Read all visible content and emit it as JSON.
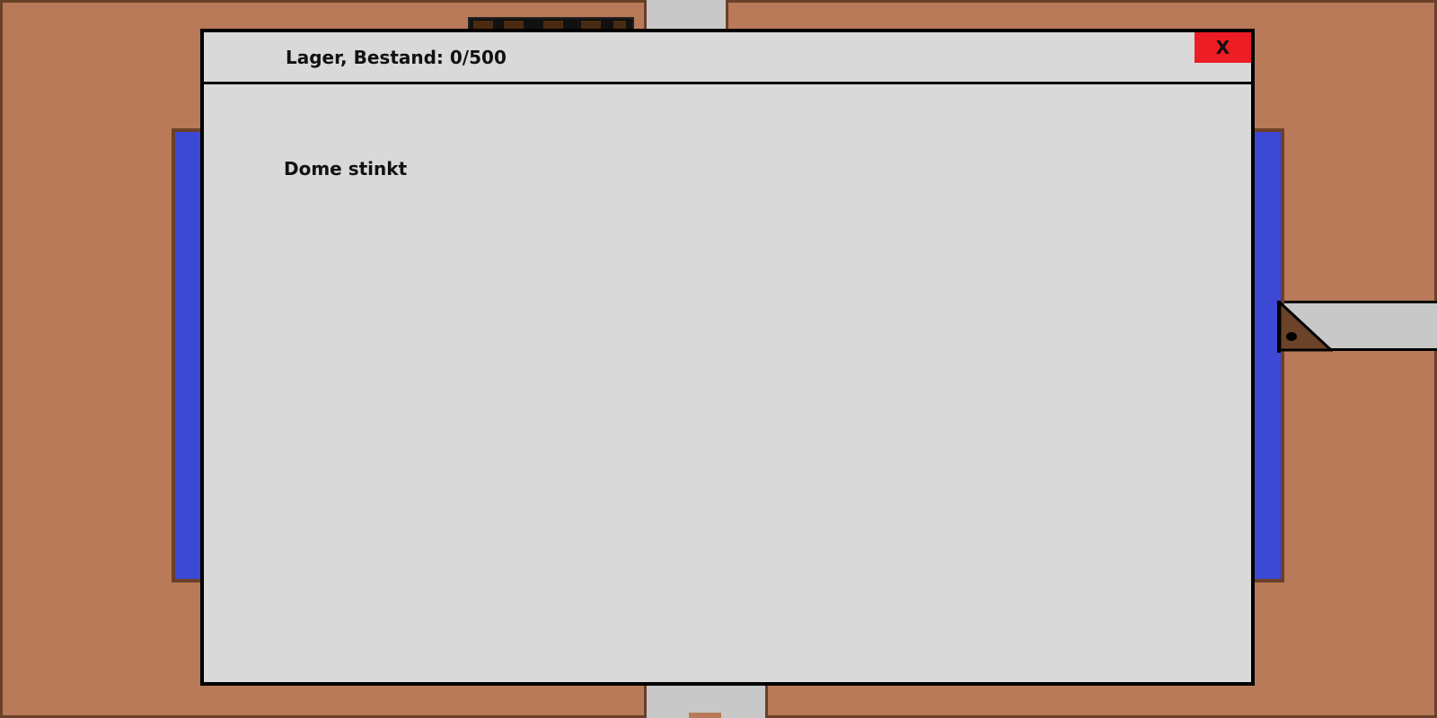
{
  "dialog": {
    "title": "Lager, Bestand: 0/500",
    "close_label": "X",
    "message": "Dome stinkt"
  },
  "storage": {
    "current": 0,
    "capacity": 500
  },
  "colors": {
    "floor": "#b87a58",
    "wall": "#6a4028",
    "corridor": "#c8c8c8",
    "storage_panel": "#3d49d4",
    "dialog_bg": "#d9d9d9",
    "close_button": "#ee1c24"
  },
  "icons": {
    "machine": "triangle-machine-icon",
    "conveyor": "conveyor-belt"
  }
}
